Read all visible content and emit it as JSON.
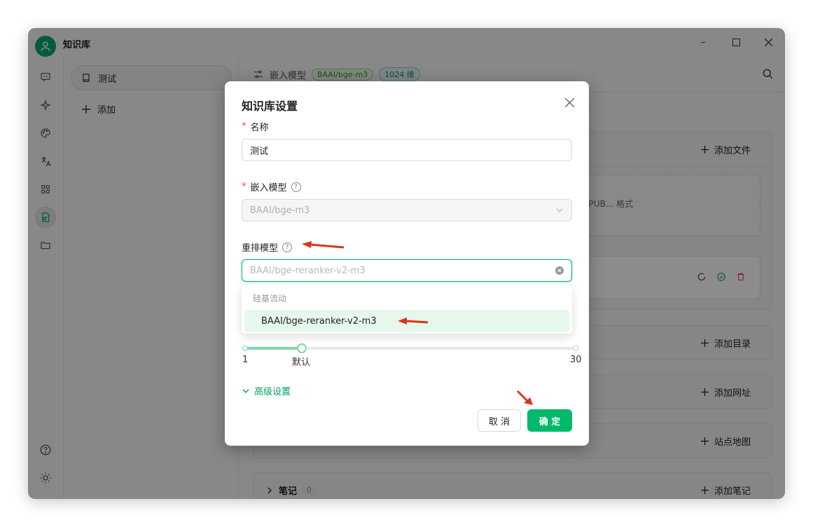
{
  "app": {
    "title": "知识库"
  },
  "window_controls": {
    "minimize": "–",
    "maximize": "□",
    "close": "×"
  },
  "sidebar": {
    "icons": [
      "chat-icon",
      "sparkle-icon",
      "palette-icon",
      "translate-icon",
      "apps-icon",
      "knowledge-icon",
      "folder-icon",
      "help-icon",
      "theme-icon",
      "settings-icon"
    ]
  },
  "knowledge_list": {
    "items": [
      {
        "label": "测试"
      }
    ],
    "add_label": "添加"
  },
  "main": {
    "embed_label": "嵌入模型",
    "embed_model_tag": "BAAI/bge-m3",
    "dimension_tag": "1024 维",
    "sections": {
      "files_action": "添加文件",
      "files_hint": "EPUB... 格式",
      "directory_action": "添加目录",
      "url_action": "添加网址",
      "sitemap_action": "站点地图",
      "notes_label": "笔记",
      "notes_count": "0",
      "notes_action": "添加笔记"
    }
  },
  "modal": {
    "title": "知识库设置",
    "name_label": "名称",
    "name_value": "测试",
    "embed_label": "嵌入模型",
    "embed_value": "BAAI/bge-m3",
    "rerank_label": "重排模型",
    "rerank_placeholder": "BAAI/bge-reranker-v2-m3",
    "dropdown": {
      "group": "硅基流动",
      "options": [
        "BAAI/bge-reranker-v2-m3"
      ]
    },
    "slider": {
      "min": "1",
      "default_label": "默认",
      "max": "30",
      "value": 6
    },
    "advanced_label": "高级设置",
    "cancel_label": "取 消",
    "ok_label": "确 定"
  },
  "colors": {
    "accent": "#00b96b",
    "arrow": "#d9361a"
  }
}
